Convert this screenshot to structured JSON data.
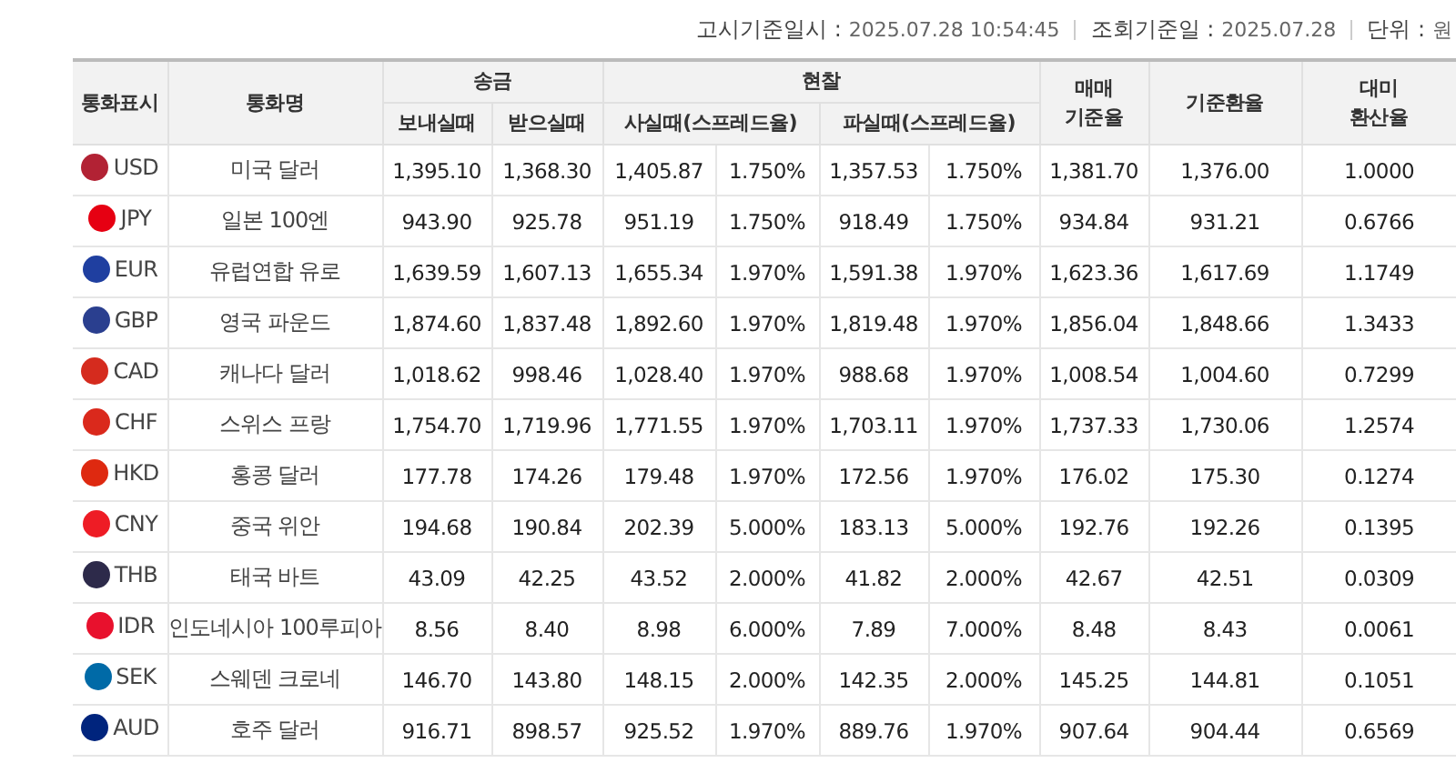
{
  "info": [
    {
      "label": "고시기준일시 :",
      "value": "2025.07.28 10:54:45"
    },
    {
      "label": "조회기준일 :",
      "value": "2025.07.28"
    },
    {
      "label": "단위 :",
      "value": "원"
    }
  ],
  "table": {
    "columns": [
      {
        "label": "통화표시"
      },
      {
        "label": "통화명"
      },
      {
        "label": "송금",
        "subcolumns": [
          {
            "label": "보내실때",
            "kind": "single"
          },
          {
            "label": "받으실때",
            "kind": "single"
          }
        ]
      },
      {
        "label": "현찰",
        "subcolumns": [
          {
            "label": "사실때(스프레드율)",
            "kind": "pair"
          },
          {
            "label": "파실때(스프레드율)",
            "kind": "pair"
          }
        ]
      },
      {
        "label": "매매\n기준율"
      },
      {
        "label": "기준환율"
      },
      {
        "label": "대미\n환산율"
      }
    ],
    "rows": [
      {
        "code": "USD",
        "color": "#b22234",
        "name": "미국 달러",
        "values": [
          "1,395.10",
          "1,368.30",
          "1,405.87",
          "1.750%",
          "1,357.53",
          "1.750%",
          "1,381.70",
          "1,376.00",
          "1.0000"
        ]
      },
      {
        "code": "JPY",
        "color": "#e60012",
        "name": "일본 100엔",
        "values": [
          "943.90",
          "925.78",
          "951.19",
          "1.750%",
          "918.49",
          "1.750%",
          "934.84",
          "931.21",
          "0.6766"
        ]
      },
      {
        "code": "EUR",
        "color": "#1f3fa0",
        "name": "유럽연합 유로",
        "values": [
          "1,639.59",
          "1,607.13",
          "1,655.34",
          "1.970%",
          "1,591.38",
          "1.970%",
          "1,623.36",
          "1,617.69",
          "1.1749"
        ]
      },
      {
        "code": "GBP",
        "color": "#2a3f8f",
        "name": "영국 파운드",
        "values": [
          "1,874.60",
          "1,837.48",
          "1,892.60",
          "1.970%",
          "1,819.48",
          "1.970%",
          "1,856.04",
          "1,848.66",
          "1.3433"
        ]
      },
      {
        "code": "CAD",
        "color": "#d52b1e",
        "name": "캐나다 달러",
        "values": [
          "1,018.62",
          "998.46",
          "1,028.40",
          "1.970%",
          "988.68",
          "1.970%",
          "1,008.54",
          "1,004.60",
          "0.7299"
        ]
      },
      {
        "code": "CHF",
        "color": "#da291c",
        "name": "스위스 프랑",
        "values": [
          "1,754.70",
          "1,719.96",
          "1,771.55",
          "1.970%",
          "1,703.11",
          "1.970%",
          "1,737.33",
          "1,730.06",
          "1.2574"
        ]
      },
      {
        "code": "HKD",
        "color": "#de2910",
        "name": "홍콩 달러",
        "values": [
          "177.78",
          "174.26",
          "179.48",
          "1.970%",
          "172.56",
          "1.970%",
          "176.02",
          "175.30",
          "0.1274"
        ]
      },
      {
        "code": "CNY",
        "color": "#ee1c25",
        "name": "중국 위안",
        "values": [
          "194.68",
          "190.84",
          "202.39",
          "5.000%",
          "183.13",
          "5.000%",
          "192.76",
          "192.26",
          "0.1395"
        ]
      },
      {
        "code": "THB",
        "color": "#2d2a4a",
        "name": "태국 바트",
        "values": [
          "43.09",
          "42.25",
          "43.52",
          "2.000%",
          "41.82",
          "2.000%",
          "42.67",
          "42.51",
          "0.0309"
        ]
      },
      {
        "code": "IDR",
        "color": "#e8112d",
        "name": "인도네시아 100루피아",
        "values": [
          "8.56",
          "8.40",
          "8.98",
          "6.000%",
          "7.89",
          "7.000%",
          "8.48",
          "8.43",
          "0.0061"
        ]
      },
      {
        "code": "SEK",
        "color": "#006aa7",
        "name": "스웨덴 크로네",
        "values": [
          "146.70",
          "143.80",
          "148.15",
          "2.000%",
          "142.35",
          "2.000%",
          "145.25",
          "144.81",
          "0.1051"
        ]
      },
      {
        "code": "AUD",
        "color": "#00247d",
        "name": "호주 달러",
        "values": [
          "916.71",
          "898.57",
          "925.52",
          "1.970%",
          "889.76",
          "1.970%",
          "907.64",
          "904.44",
          "0.6569"
        ]
      }
    ]
  }
}
